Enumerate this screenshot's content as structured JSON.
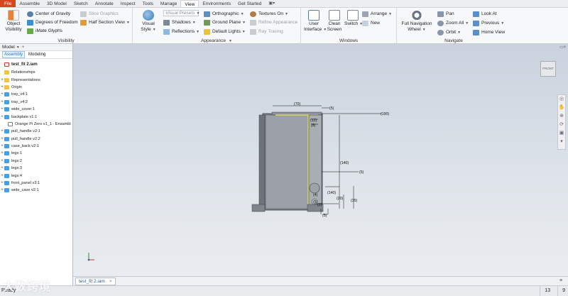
{
  "menu": {
    "tabs": [
      "File",
      "Assemble",
      "3D Model",
      "Sketch",
      "Annotate",
      "Inspect",
      "Tools",
      "Manage",
      "View",
      "Environments",
      "Get Started"
    ],
    "active": "View"
  },
  "ribbon": {
    "visibility": {
      "title": "Visibility",
      "object_visibility": "Object Visibility",
      "center_of_gravity": "Center of Gravity",
      "degrees_of_freedom": "Degrees of Freedom",
      "imate_glyphs": "iMate Glyphs",
      "slice_graphics": "Slice Graphics",
      "half_section_view": "Half Section View"
    },
    "appearance": {
      "title": "Appearance",
      "visual_style": "Visual Style",
      "visual_presets": "Visual Presets",
      "shadows": "Shadows",
      "reflections": "Reflections",
      "orthographic": "Orthographic",
      "ground_plane": "Ground Plane",
      "default_lights": "Default Lights",
      "textures_on": "Textures On",
      "refine_appearance": "Refine Appearance",
      "ray_tracing": "Ray Tracing"
    },
    "windows": {
      "title": "Windows",
      "user_interface": "User Interface",
      "clean_screen": "Clean Screen",
      "switch": "Switch",
      "arrange": "Arrange",
      "new": "New"
    },
    "navigate": {
      "title": "Navigate",
      "full_navigation_wheel": "Full Navigation Wheel",
      "pan": "Pan",
      "zoom_all": "Zoom All",
      "orbit": "Orbit",
      "look_at": "Look At",
      "previous": "Previous",
      "home_view": "Home View"
    }
  },
  "browser": {
    "header": "Model",
    "add": "+",
    "tabs": [
      "Assembly",
      "Modeling"
    ],
    "root": "test_fit 2.iam",
    "items": [
      {
        "label": "Relationships",
        "icon": "folder-icon",
        "expand": ""
      },
      {
        "label": "Representations",
        "icon": "folder-icon",
        "expand": "+"
      },
      {
        "label": "Origin",
        "icon": "folder-icon",
        "expand": "+"
      },
      {
        "label": "tray_v4:1",
        "icon": "part-icon",
        "expand": "+"
      },
      {
        "label": "tray_v4:2",
        "icon": "part-icon",
        "expand": "+"
      },
      {
        "label": "wide_cover:1",
        "icon": "part-icon",
        "expand": "+"
      },
      {
        "label": "backplate v1:1",
        "icon": "part-icon",
        "expand": "+"
      },
      {
        "label": "Orange Pi Zero v1_1 - Ensambl",
        "icon": "warning-icon",
        "expand": ""
      },
      {
        "label": "pull_handle v2:1",
        "icon": "part-icon",
        "expand": "+"
      },
      {
        "label": "pull_handle v2:2",
        "icon": "part-icon",
        "expand": "+"
      },
      {
        "label": "case_back v2:1",
        "icon": "part-icon",
        "expand": "+"
      },
      {
        "label": "legs:1",
        "icon": "part-icon",
        "expand": "+"
      },
      {
        "label": "legs:2",
        "icon": "part-icon",
        "expand": "+"
      },
      {
        "label": "legs:3",
        "icon": "part-icon",
        "expand": "+"
      },
      {
        "label": "legs:4",
        "icon": "part-icon",
        "expand": "+"
      },
      {
        "label": "front_panel v3:1",
        "icon": "part-icon",
        "expand": "+"
      },
      {
        "label": "wide_case v2:1",
        "icon": "part-icon",
        "expand": "+"
      }
    ]
  },
  "viewport": {
    "viewcube_label": "FRONT",
    "dimensions": [
      "(70)",
      "(5)",
      "(190)",
      "(12)",
      "(8)",
      "(140)",
      "(5)",
      "(140)",
      "(4)",
      "(20)",
      "(35)",
      "(5)",
      "(5)",
      "(2)"
    ]
  },
  "document_tab": {
    "label": "test_fit 2.iam",
    "close": "×"
  },
  "status": {
    "text": "Ready",
    "num1": "13",
    "num2": "9"
  },
  "watermark": "大数跨境",
  "colors": {
    "file_tab": "#d8461c",
    "accent": "#1a6fc4",
    "part": "#4a9fe0",
    "folder": "#efc24a",
    "highlight": "#e8e24a"
  }
}
